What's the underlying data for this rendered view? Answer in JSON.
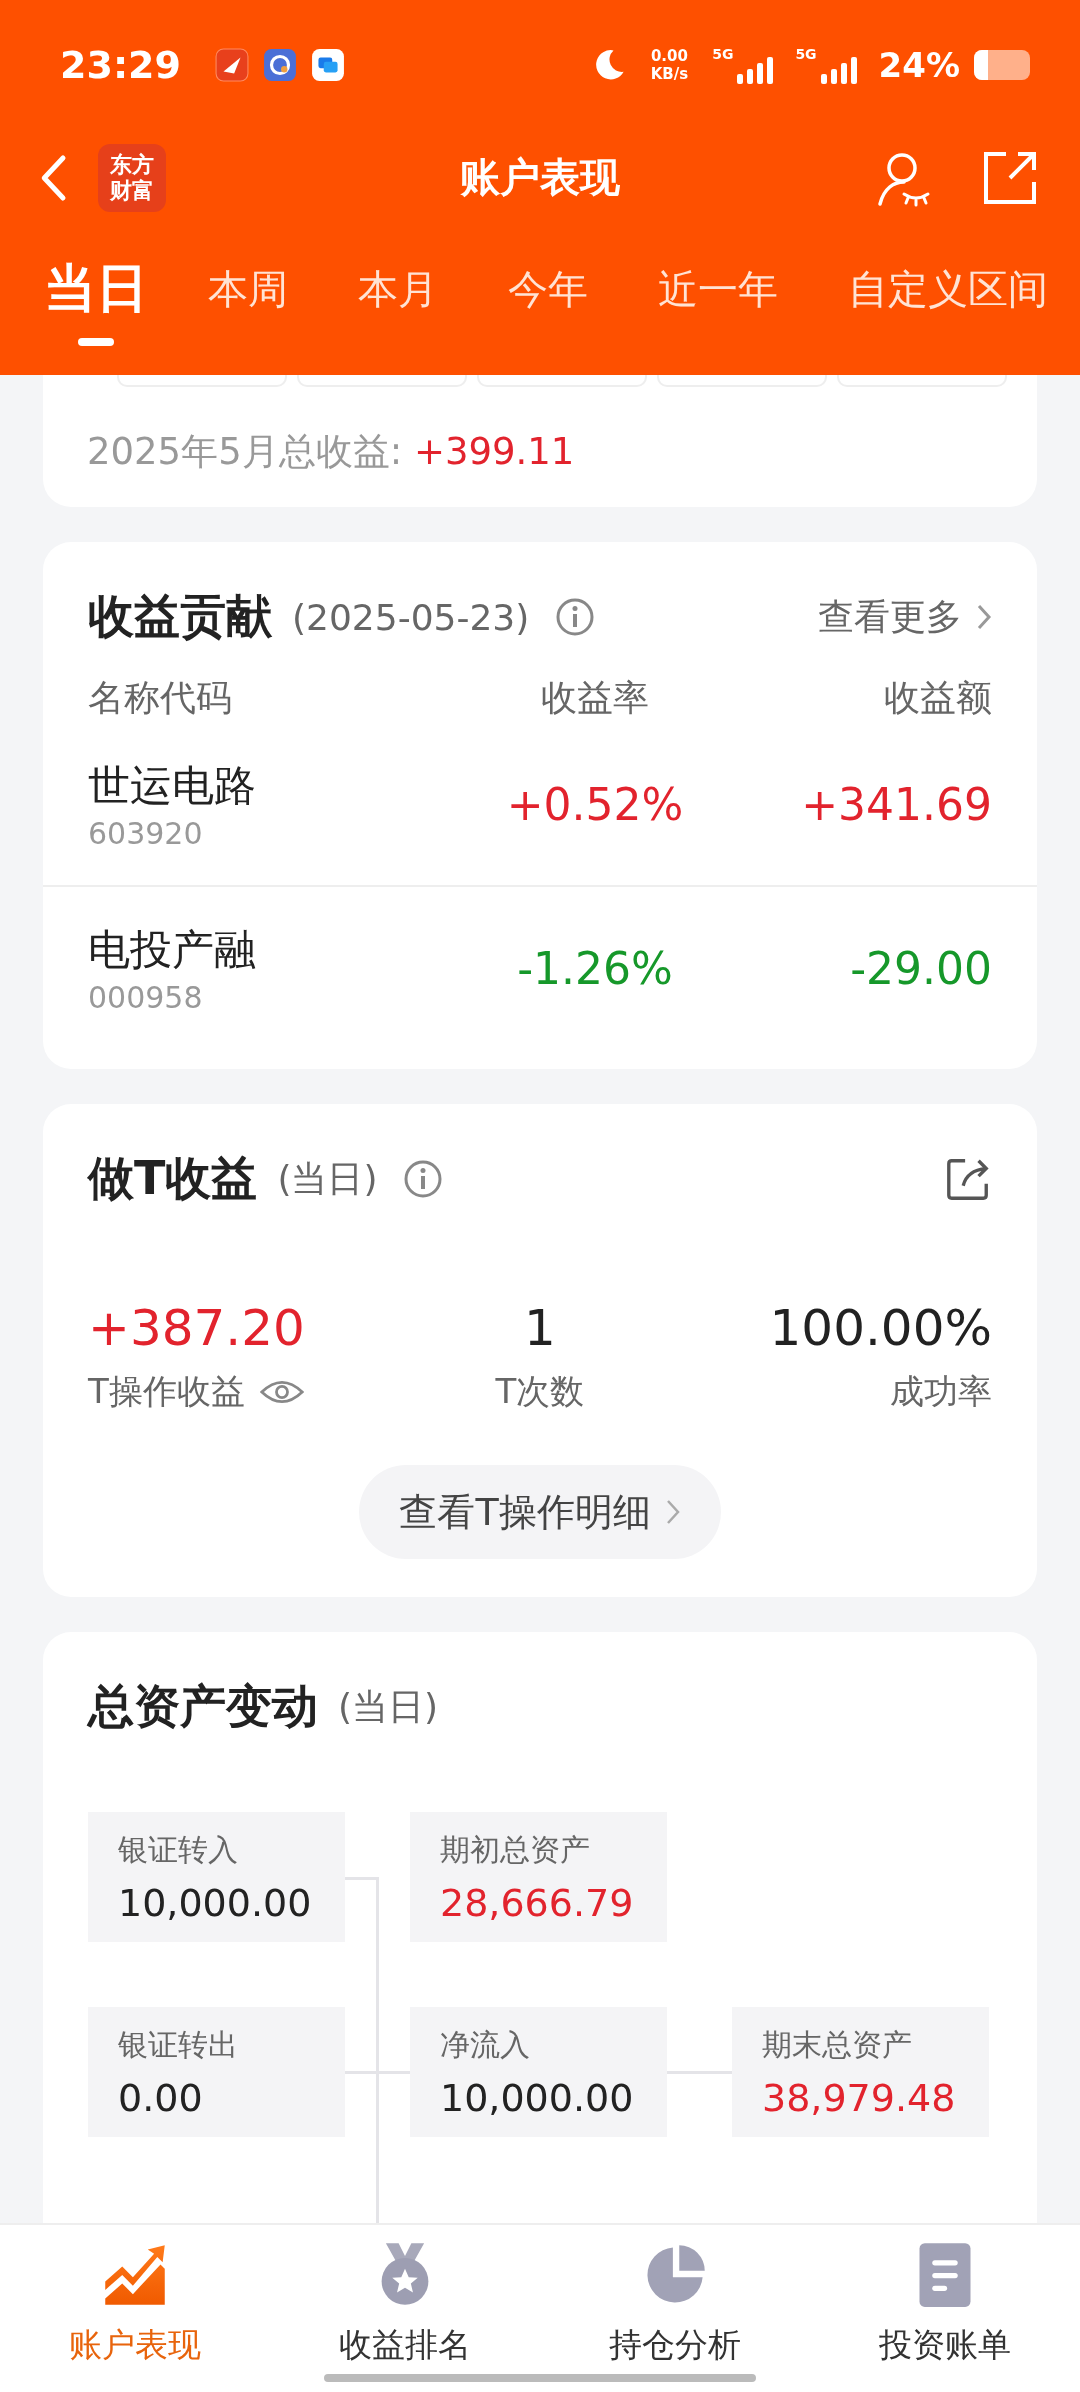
{
  "status_bar": {
    "time": "23:29",
    "net_speed": [
      "0.00",
      "KB/s"
    ],
    "signals": [
      "5G",
      "5G"
    ],
    "battery": "24%"
  },
  "header": {
    "logo": [
      "东方",
      "财富"
    ],
    "title": "账户表现"
  },
  "tabs": [
    {
      "label": "当日",
      "selected": true
    },
    {
      "label": "本周",
      "selected": false
    },
    {
      "label": "本月",
      "selected": false
    },
    {
      "label": "今年",
      "selected": false
    },
    {
      "label": "近一年",
      "selected": false
    },
    {
      "label": "自定义区间",
      "selected": false
    }
  ],
  "month_summary": {
    "label": "2025年5月总收益:",
    "value": "+399.11"
  },
  "contribution": {
    "title": "收益贡献",
    "date": "(2025-05-23)",
    "more": "查看更多",
    "columns": [
      "名称代码",
      "收益率",
      "收益额"
    ],
    "rows": [
      {
        "name": "世运电路",
        "code": "603920",
        "rate": "+0.52%",
        "amount": "+341.69",
        "kind": "gain"
      },
      {
        "name": "电投产融",
        "code": "000958",
        "rate": "-1.26%",
        "amount": "-29.00",
        "kind": "loss"
      }
    ]
  },
  "t_profit": {
    "title": "做T收益",
    "period": "(当日)",
    "stats": [
      {
        "value": "+387.20",
        "label": "T操作收益",
        "kind": "gain"
      },
      {
        "value": "1",
        "label": "T次数",
        "kind": "plain"
      },
      {
        "value": "100.00%",
        "label": "成功率",
        "kind": "plain"
      }
    ],
    "button": "查看T操作明细"
  },
  "asset_change": {
    "title": "总资产变动",
    "period": "(当日)",
    "boxes": [
      {
        "label": "银证转入",
        "value": "10,000.00",
        "kind": "plain"
      },
      {
        "label": "期初总资产",
        "value": "28,666.79",
        "kind": "gain"
      },
      {
        "label": "银证转出",
        "value": "0.00",
        "kind": "plain"
      },
      {
        "label": "净流入",
        "value": "10,000.00",
        "kind": "plain"
      },
      {
        "label": "期末总资产",
        "value": "38,979.48",
        "kind": "gain"
      }
    ]
  },
  "nav": [
    {
      "label": "账户表现",
      "selected": true
    },
    {
      "label": "收益排名",
      "selected": false
    },
    {
      "label": "持仓分析",
      "selected": false
    },
    {
      "label": "投资账单",
      "selected": false
    }
  ]
}
